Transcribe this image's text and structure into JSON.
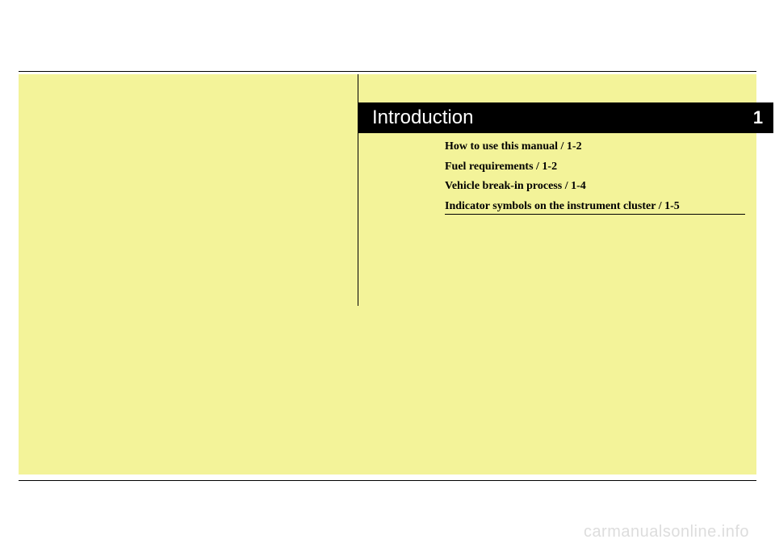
{
  "chapter": {
    "title": "Introduction",
    "number": "1"
  },
  "toc": {
    "items": [
      "How to use this manual / 1-2",
      "Fuel requirements / 1-2",
      "Vehicle break-in process / 1-4",
      "Indicator symbols on the instrument cluster / 1-5"
    ]
  },
  "watermark": "carmanualsonline.info"
}
